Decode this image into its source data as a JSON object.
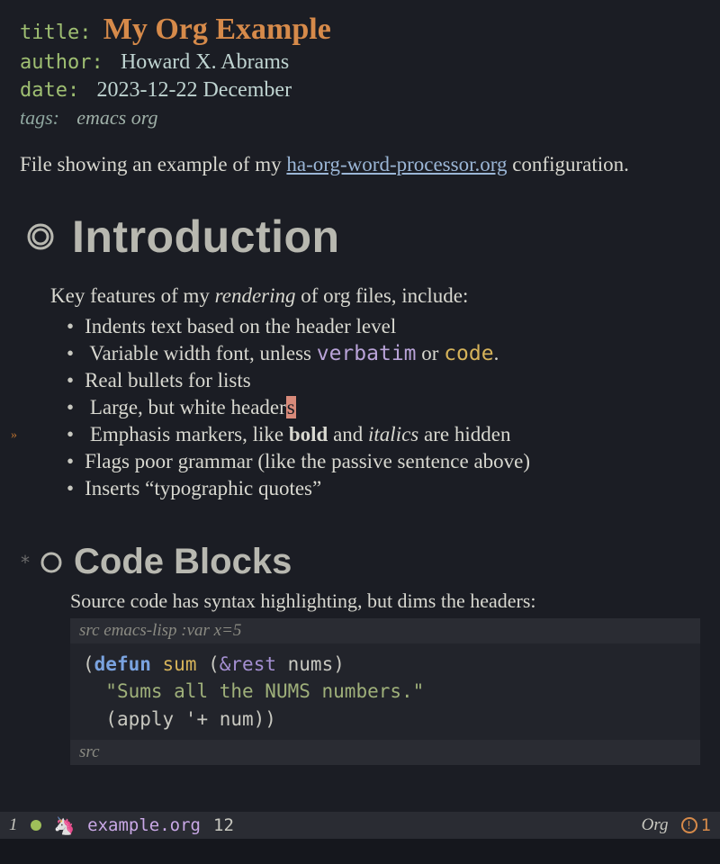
{
  "meta": {
    "title_key": "title:",
    "title_val": "My Org Example",
    "author_key": "author:",
    "author_val": "Howard X. Abrams",
    "date_key": "date:",
    "date_val": "2023-12-22 December",
    "tags_key": "tags:",
    "tags_val": "emacs org"
  },
  "intro_para": {
    "pre": "File showing an example of my ",
    "link": "ha-org-word-processor.org",
    "post": " configuration."
  },
  "h1": "Introduction",
  "body": {
    "lead_pre": "Key features of my ",
    "lead_em": "rendering",
    "lead_post": " of org files, include:",
    "bullets": {
      "b1": "Indents text based on the header level",
      "b2_pre": "Variable width font, unless ",
      "b2_verb": "verbatim",
      "b2_mid": " or ",
      "b2_code": "code",
      "b2_post": ".",
      "b3": "Real bullets for lists",
      "b4_pre": "Large, but white header",
      "b4_cursor": "s",
      "b5_pre": "Emphasis markers, like ",
      "b5_bold": "bold",
      "b5_mid": " and ",
      "b5_italic": "italics",
      "b5_post": " are hidden",
      "b6": "Flags poor grammar (like the passive sentence above)",
      "b7": "Inserts “typographic quotes”"
    }
  },
  "h2_star": "*",
  "h2": "Code Blocks",
  "src_intro": "Source code has syntax highlighting, but dims the headers:",
  "src": {
    "header": "src emacs-lisp :var x=5",
    "l1_open": "(",
    "l1_def": "defun",
    "l1_sp": " ",
    "l1_fn": "sum",
    "l1_sp2": " (",
    "l1_amp": "&rest",
    "l1_sp3": " ",
    "l1_arg": "nums",
    "l1_close": ")",
    "l2_str": "\"Sums all the NUMS numbers.\"",
    "l3": "(apply '+ num))",
    "footer": "src"
  },
  "modeline": {
    "evil": "1",
    "file": "example.org",
    "line": "12",
    "mode": "Org",
    "warn": "1"
  }
}
